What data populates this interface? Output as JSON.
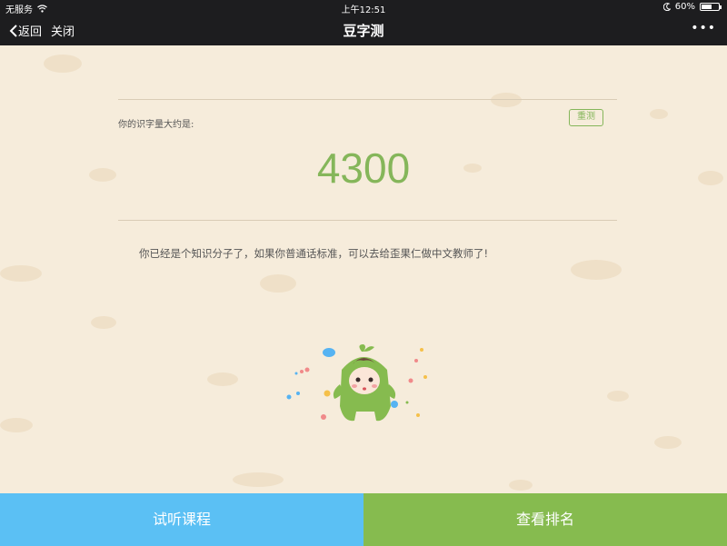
{
  "status_bar": {
    "carrier": "无服务",
    "time": "上午12:51",
    "battery": "60%",
    "battery_level": 0.6
  },
  "nav": {
    "back_label": "返回",
    "close_label": "关闭",
    "title": "豆字测",
    "more_label": "•••"
  },
  "result": {
    "prompt": "你的识字量大约是:",
    "retest_label": "重测",
    "score": "4300",
    "message": "你已经是个知识分子了，如果你普通话标准，可以去给歪果仁做中文教师了!"
  },
  "buttons": {
    "trial_label": "试听课程",
    "ranking_label": "查看排名"
  },
  "colors": {
    "accent_green": "#85b65a",
    "button_blue": "#5bc0f4",
    "button_green": "#86bb4f",
    "background": "#f6ecdb",
    "bar": "#1d1d1f"
  }
}
